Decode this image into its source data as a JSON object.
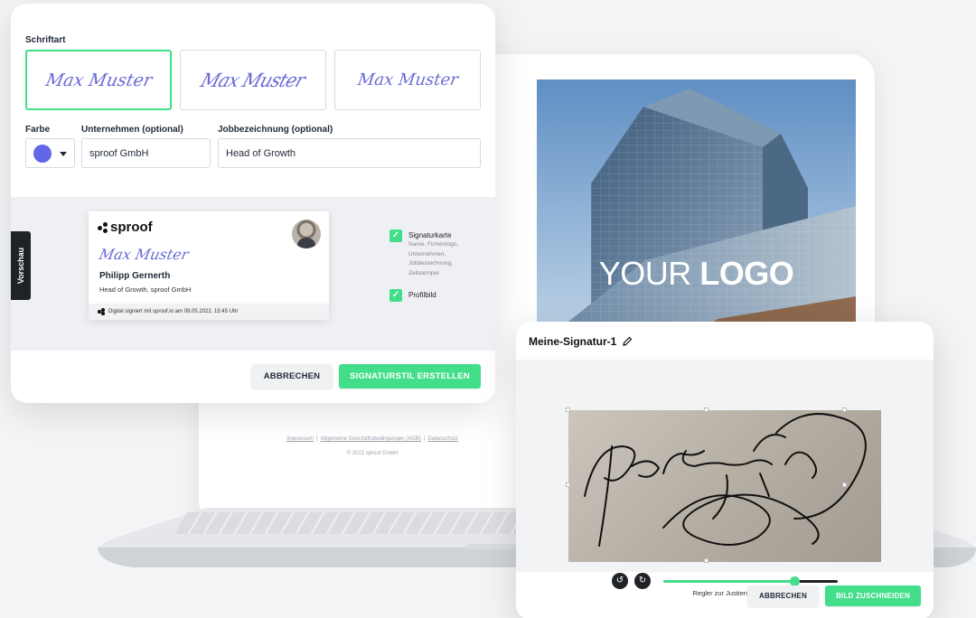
{
  "logo_overlay": {
    "regular": "YOUR",
    "bold": "LOGO"
  },
  "footer": {
    "links": [
      "Impressum",
      "Allgemeine Geschäftsbedingungen (AGB)",
      "Datenschutz"
    ],
    "copyright": "© 2022 sproof GmbH"
  },
  "style_panel": {
    "font_label": "Schriftart",
    "font_options": [
      "Max Muster",
      "Max Muster",
      "Max Muster"
    ],
    "selected_font_index": 0,
    "color_label": "Farbe",
    "selected_color": "#6366e8",
    "company_label": "Unternehmen (optional)",
    "company_value": "sproof GmbH",
    "job_label": "Jobbezeichnung (optional)",
    "job_value": "Head of Growth",
    "preview_tab": "Vorschau",
    "preview_card": {
      "brand": "sproof",
      "signature": "Max Muster",
      "name": "Philipp Gernerth",
      "title": "Head of Growth, sproof GmbH",
      "footer": "Digital signiert mit sproof.io am 09.05.2022, 15:45 Uhr"
    },
    "options": [
      {
        "title": "Signaturkarte",
        "description": "Name, Firmenlogo, Unternehmen, Jobbezeichnung, Zeitstempel",
        "checked": true
      },
      {
        "title": "Profilbild",
        "description": "",
        "checked": true
      }
    ],
    "cancel_label": "ABBRECHEN",
    "submit_label": "SIGNATURSTIL ERSTELLEN",
    "accent": "#43de8a"
  },
  "crop_panel": {
    "title": "Meine-Signatur-1",
    "slider_label": "Regler zur Justierung der Transparenz",
    "slider_value": 0.75,
    "cancel_label": "ABBRECHEN",
    "submit_label": "BILD ZUSCHNEIDEN"
  }
}
